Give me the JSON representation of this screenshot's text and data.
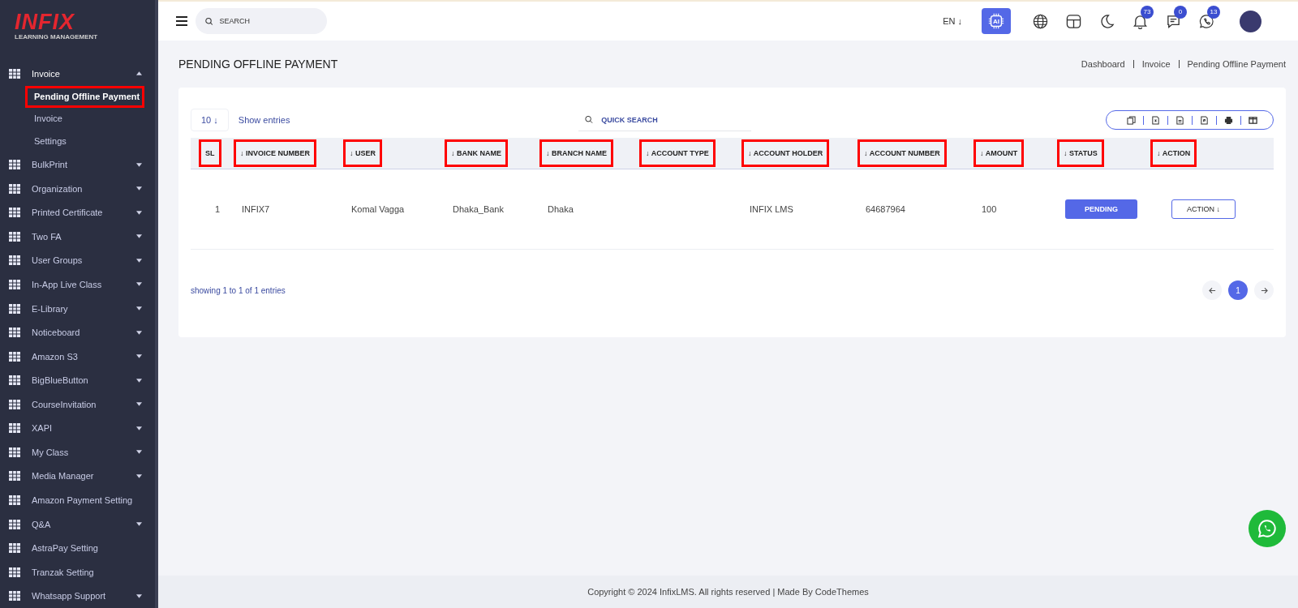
{
  "logo": {
    "brand": "INFIX",
    "tagline": "LEARNING MANAGEMENT"
  },
  "sidebar": {
    "items": [
      {
        "label": "Invoice",
        "has_children": true,
        "expanded": true,
        "children": [
          {
            "label": "Pending Offline Payment",
            "selected": true,
            "highlighted": true
          },
          {
            "label": "Invoice",
            "selected": false,
            "highlighted": false
          },
          {
            "label": "Settings",
            "selected": false,
            "highlighted": false
          }
        ]
      },
      {
        "label": "BulkPrint",
        "has_children": true,
        "expanded": false
      },
      {
        "label": "Organization",
        "has_children": true,
        "expanded": false
      },
      {
        "label": "Printed Certificate",
        "has_children": true,
        "expanded": false
      },
      {
        "label": "Two FA",
        "has_children": true,
        "expanded": false
      },
      {
        "label": "User Groups",
        "has_children": true,
        "expanded": false
      },
      {
        "label": "In-App Live Class",
        "has_children": true,
        "expanded": false
      },
      {
        "label": "E-Library",
        "has_children": true,
        "expanded": false
      },
      {
        "label": "Noticeboard",
        "has_children": true,
        "expanded": false
      },
      {
        "label": "Amazon S3",
        "has_children": true,
        "expanded": false
      },
      {
        "label": "BigBlueButton",
        "has_children": true,
        "expanded": false
      },
      {
        "label": "CourseInvitation",
        "has_children": true,
        "expanded": false
      },
      {
        "label": "XAPI",
        "has_children": true,
        "expanded": false
      },
      {
        "label": "My Class",
        "has_children": true,
        "expanded": false
      },
      {
        "label": "Media Manager",
        "has_children": true,
        "expanded": false
      },
      {
        "label": "Amazon Payment Setting",
        "has_children": false,
        "expanded": false
      },
      {
        "label": "Q&A",
        "has_children": true,
        "expanded": false
      },
      {
        "label": "AstraPay Setting",
        "has_children": false,
        "expanded": false
      },
      {
        "label": "Tranzak Setting",
        "has_children": false,
        "expanded": false
      },
      {
        "label": "Whatsapp Support",
        "has_children": true,
        "expanded": false
      }
    ]
  },
  "topbar": {
    "search_placeholder": "SEARCH",
    "language": "EN ↓",
    "ai_label": "AI",
    "notifications": "73",
    "messages": "0",
    "calls": "13"
  },
  "page": {
    "title": "PENDING OFFLINE PAYMENT",
    "breadcrumbs": [
      "Dashboard",
      "Invoice",
      "Pending Offline Payment"
    ]
  },
  "table": {
    "page_size": "10 ↓",
    "show_entries": "Show entries",
    "quick_search_placeholder": "QUICK SEARCH",
    "columns": [
      {
        "label": "SL",
        "sortable": false,
        "highlighted": true
      },
      {
        "label": "↓ INVOICE NUMBER",
        "sortable": true,
        "highlighted": true
      },
      {
        "label": "↓ USER",
        "sortable": true,
        "highlighted": true
      },
      {
        "label": "↓ BANK NAME",
        "sortable": true,
        "highlighted": true
      },
      {
        "label": "↓ BRANCH NAME",
        "sortable": true,
        "highlighted": true
      },
      {
        "label": "↓ ACCOUNT TYPE",
        "sortable": true,
        "highlighted": true
      },
      {
        "label": "↓ ACCOUNT HOLDER",
        "sortable": true,
        "highlighted": true
      },
      {
        "label": "↓ ACCOUNT NUMBER",
        "sortable": true,
        "highlighted": true
      },
      {
        "label": "↓ AMOUNT",
        "sortable": true,
        "highlighted": true
      },
      {
        "label": "↓ STATUS",
        "sortable": true,
        "highlighted": true
      },
      {
        "label": "↓ ACTION",
        "sortable": true,
        "highlighted": true
      }
    ],
    "rows": [
      {
        "sl": "1",
        "invoice_number": "INFIX7",
        "user": "Komal Vagga",
        "bank_name": "Dhaka_Bank",
        "branch_name": "Dhaka",
        "account_holder": "INFIX LMS",
        "account_number": "64687964",
        "amount": "100",
        "status": "PENDING",
        "action": "ACTION ↓"
      }
    ],
    "summary": "showing 1 to 1 of 1 entries",
    "pages": [
      {
        "label": "1",
        "selected": true
      }
    ]
  },
  "footer": "Copyright © 2024 InfixLMS. All rights reserved | Made By CodeThemes"
}
